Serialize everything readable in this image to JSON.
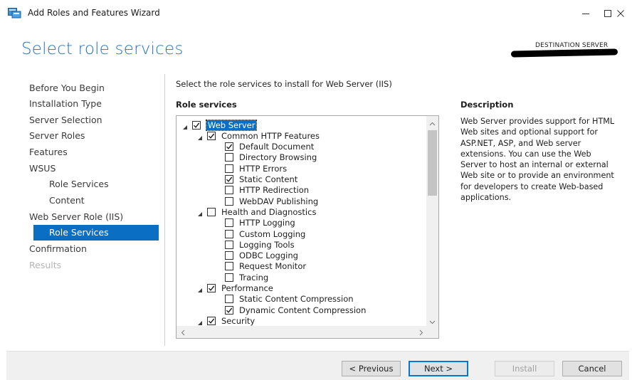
{
  "window": {
    "title": "Add Roles and Features Wizard",
    "icon": "server-manager-icon"
  },
  "header": {
    "page_title": "Select role services",
    "destination_label": "DESTINATION SERVER",
    "destination_value": "[redacted]"
  },
  "nav": {
    "items": [
      {
        "label": "Before You Begin",
        "level": 0,
        "state": "normal"
      },
      {
        "label": "Installation Type",
        "level": 0,
        "state": "normal"
      },
      {
        "label": "Server Selection",
        "level": 0,
        "state": "normal"
      },
      {
        "label": "Server Roles",
        "level": 0,
        "state": "normal"
      },
      {
        "label": "Features",
        "level": 0,
        "state": "normal"
      },
      {
        "label": "WSUS",
        "level": 0,
        "state": "normal"
      },
      {
        "label": "Role Services",
        "level": 1,
        "state": "normal"
      },
      {
        "label": "Content",
        "level": 1,
        "state": "normal"
      },
      {
        "label": "Web Server Role (IIS)",
        "level": 0,
        "state": "normal"
      },
      {
        "label": "Role Services",
        "level": 1,
        "state": "active"
      },
      {
        "label": "Confirmation",
        "level": 0,
        "state": "normal"
      },
      {
        "label": "Results",
        "level": 0,
        "state": "disabled"
      }
    ]
  },
  "main": {
    "instruction": "Select the role services to install for Web Server (IIS)",
    "role_services_heading": "Role services",
    "tree": [
      {
        "label": "Web Server",
        "level": 0,
        "checked": true,
        "expanded": true,
        "selected": true
      },
      {
        "label": "Common HTTP Features",
        "level": 1,
        "checked": true,
        "expanded": true
      },
      {
        "label": "Default Document",
        "level": 2,
        "checked": true
      },
      {
        "label": "Directory Browsing",
        "level": 2,
        "checked": false
      },
      {
        "label": "HTTP Errors",
        "level": 2,
        "checked": false
      },
      {
        "label": "Static Content",
        "level": 2,
        "checked": true
      },
      {
        "label": "HTTP Redirection",
        "level": 2,
        "checked": false
      },
      {
        "label": "WebDAV Publishing",
        "level": 2,
        "checked": false
      },
      {
        "label": "Health and Diagnostics",
        "level": 1,
        "checked": false,
        "expanded": true
      },
      {
        "label": "HTTP Logging",
        "level": 2,
        "checked": false
      },
      {
        "label": "Custom Logging",
        "level": 2,
        "checked": false
      },
      {
        "label": "Logging Tools",
        "level": 2,
        "checked": false
      },
      {
        "label": "ODBC Logging",
        "level": 2,
        "checked": false
      },
      {
        "label": "Request Monitor",
        "level": 2,
        "checked": false
      },
      {
        "label": "Tracing",
        "level": 2,
        "checked": false
      },
      {
        "label": "Performance",
        "level": 1,
        "checked": true,
        "expanded": true
      },
      {
        "label": "Static Content Compression",
        "level": 2,
        "checked": false
      },
      {
        "label": "Dynamic Content Compression",
        "level": 2,
        "checked": true
      },
      {
        "label": "Security",
        "level": 1,
        "checked": true,
        "expanded": true
      }
    ],
    "description_heading": "Description",
    "description_text": "Web Server provides support for HTML Web sites and optional support for ASP.NET, ASP, and Web server extensions. You can use the Web Server to host an internal or external Web site or to provide an environment for developers to create Web-based applications."
  },
  "buttons": {
    "previous": "< Previous",
    "next": "Next >",
    "install": "Install",
    "cancel": "Cancel"
  },
  "colors": {
    "accent": "#0a6fc2",
    "title_blue": "#1e73c8"
  }
}
